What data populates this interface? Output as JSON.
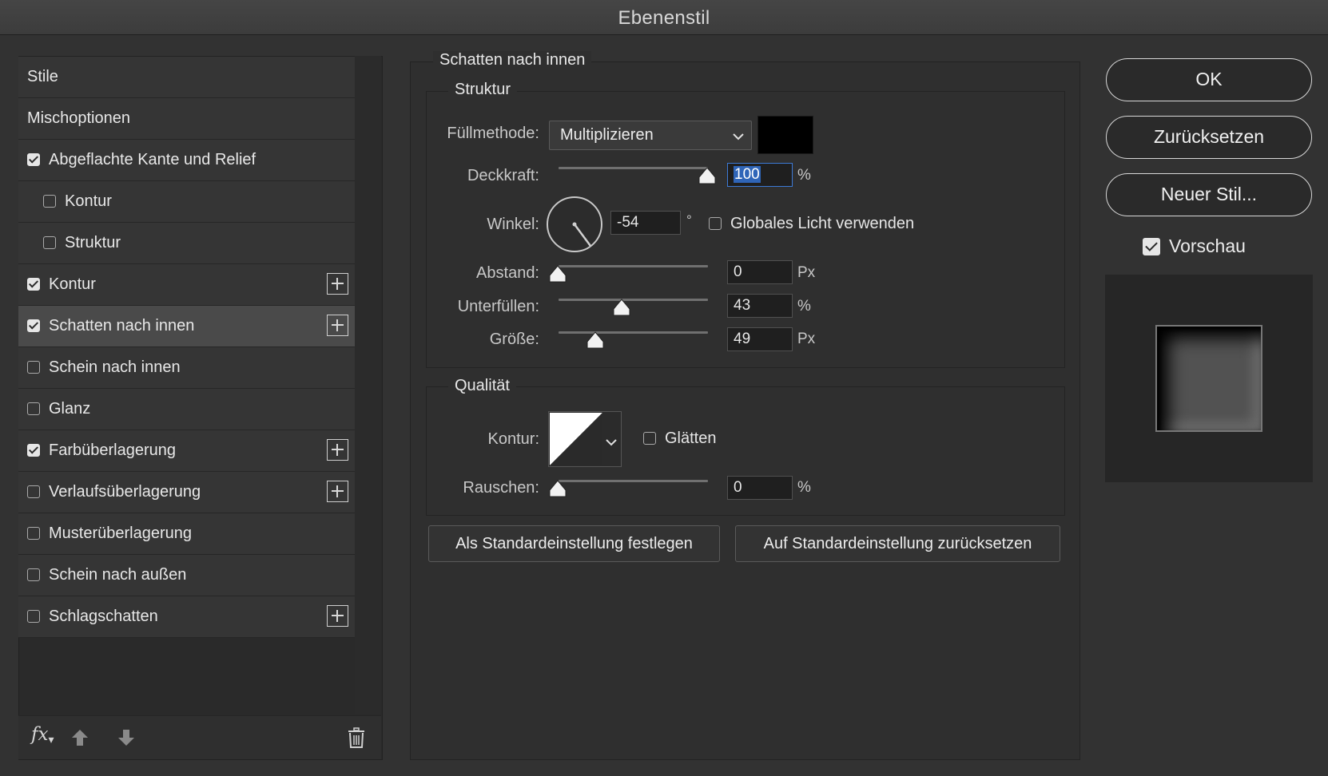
{
  "window": {
    "title": "Ebenenstil"
  },
  "styles_list": {
    "items": [
      {
        "label": "Stile",
        "checkbox": null,
        "plus": false,
        "indent": 0,
        "selected": false
      },
      {
        "label": "Mischoptionen",
        "checkbox": null,
        "plus": false,
        "indent": 0,
        "selected": false
      },
      {
        "label": "Abgeflachte Kante und Relief",
        "checkbox": true,
        "plus": false,
        "indent": 0,
        "selected": false
      },
      {
        "label": "Kontur",
        "checkbox": false,
        "plus": false,
        "indent": 1,
        "selected": false
      },
      {
        "label": "Struktur",
        "checkbox": false,
        "plus": false,
        "indent": 1,
        "selected": false
      },
      {
        "label": "Kontur",
        "checkbox": true,
        "plus": true,
        "indent": 0,
        "selected": false
      },
      {
        "label": "Schatten nach innen",
        "checkbox": true,
        "plus": true,
        "indent": 0,
        "selected": true
      },
      {
        "label": "Schein nach innen",
        "checkbox": false,
        "plus": false,
        "indent": 0,
        "selected": false
      },
      {
        "label": "Glanz",
        "checkbox": false,
        "plus": false,
        "indent": 0,
        "selected": false
      },
      {
        "label": "Farbüberlagerung",
        "checkbox": true,
        "plus": true,
        "indent": 0,
        "selected": false
      },
      {
        "label": "Verlaufsüberlagerung",
        "checkbox": false,
        "plus": true,
        "indent": 0,
        "selected": false
      },
      {
        "label": "Musterüberlagerung",
        "checkbox": false,
        "plus": false,
        "indent": 0,
        "selected": false
      },
      {
        "label": "Schein nach außen",
        "checkbox": false,
        "plus": false,
        "indent": 0,
        "selected": false
      },
      {
        "label": "Schlagschatten",
        "checkbox": false,
        "plus": true,
        "indent": 0,
        "selected": false
      }
    ],
    "footer": {
      "fx_label": "fx",
      "icons": [
        "fx-icon",
        "arrow-up-icon",
        "arrow-down-icon",
        "trash-icon"
      ]
    }
  },
  "inner_shadow": {
    "section_title": "Schatten nach innen",
    "structure": {
      "title": "Struktur",
      "blend_mode_label": "Füllmethode:",
      "blend_mode_value": "Multiplizieren",
      "shadow_color": "#000000",
      "opacity_label": "Deckkraft:",
      "opacity_value": "100",
      "opacity_unit": "%",
      "opacity_level": 100,
      "angle_label": "Winkel:",
      "angle_value": "-54",
      "angle_unit": "°",
      "global_light_label": "Globales Licht verwenden",
      "global_light_checked": false,
      "distance_label": "Abstand:",
      "distance_value": "0",
      "distance_unit": "Px",
      "distance_level": 0,
      "choke_label": "Unterfüllen:",
      "choke_value": "43",
      "choke_unit": "%",
      "choke_level": 43,
      "size_label": "Größe:",
      "size_value": "49",
      "size_unit": "Px",
      "size_level": 0.25
    },
    "quality": {
      "title": "Qualität",
      "contour_label": "Kontur:",
      "antialias_label": "Glätten",
      "antialias_checked": false,
      "noise_label": "Rauschen:",
      "noise_value": "0",
      "noise_unit": "%",
      "noise_level": 0
    },
    "make_default_label": "Als Standardeinstellung festlegen",
    "reset_default_label": "Auf Standardeinstellung zurücksetzen"
  },
  "actions": {
    "ok_label": "OK",
    "reset_label": "Zurücksetzen",
    "new_style_label": "Neuer Stil...",
    "preview_label": "Vorschau",
    "preview_checked": true
  }
}
